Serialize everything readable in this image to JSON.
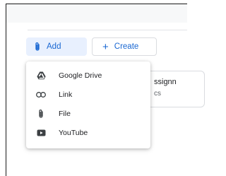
{
  "toolbar": {
    "add_label": "Add",
    "create_label": "Create",
    "create_icon": "+"
  },
  "add_menu": {
    "items": [
      {
        "label": "Google Drive",
        "icon": "google-drive-icon"
      },
      {
        "label": "Link",
        "icon": "link-icon"
      },
      {
        "label": "File",
        "icon": "paperclip-icon"
      },
      {
        "label": "YouTube",
        "icon": "youtube-icon"
      }
    ]
  },
  "background_card": {
    "title_fragment": "ssignn",
    "subtitle_fragment": "cs"
  },
  "colors": {
    "accent": "#1967d2",
    "add_button_bg": "#e8f0fe",
    "menu_icon": "#3c4043"
  }
}
